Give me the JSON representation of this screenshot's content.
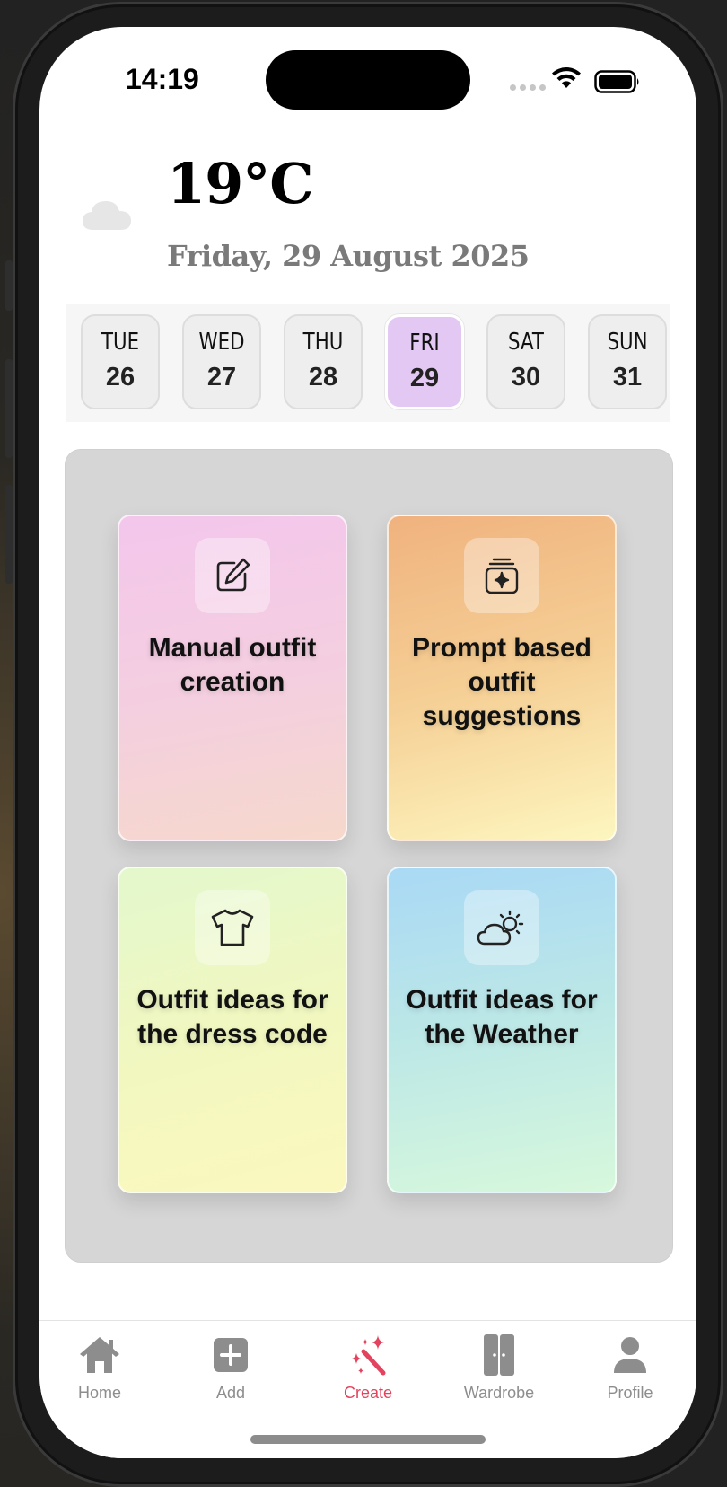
{
  "status_bar": {
    "time": "14:19"
  },
  "weather": {
    "icon": "cloud-icon",
    "temperature": "19°C",
    "date": "Friday, 29 August 2025"
  },
  "days": [
    {
      "name": "TUE",
      "number": "26",
      "selected": false
    },
    {
      "name": "WED",
      "number": "27",
      "selected": false
    },
    {
      "name": "THU",
      "number": "28",
      "selected": false
    },
    {
      "name": "FRI",
      "number": "29",
      "selected": true
    },
    {
      "name": "SAT",
      "number": "30",
      "selected": false
    },
    {
      "name": "SUN",
      "number": "31",
      "selected": false
    }
  ],
  "options": [
    {
      "label": "Manual outfit creation",
      "icon": "edit-icon"
    },
    {
      "label": "Prompt based outfit suggestions",
      "icon": "sparkle-stack-icon"
    },
    {
      "label": "Outfit ideas for the dress code",
      "icon": "tshirt-icon"
    },
    {
      "label": "Outfit ideas for the Weather",
      "icon": "cloud-sun-icon"
    }
  ],
  "tabs": [
    {
      "label": "Home",
      "icon": "house-icon",
      "active": false
    },
    {
      "label": "Add",
      "icon": "plus-square-icon",
      "active": false
    },
    {
      "label": "Create",
      "icon": "magic-wand-icon",
      "active": true
    },
    {
      "label": "Wardrobe",
      "icon": "wardrobe-icon",
      "active": false
    },
    {
      "label": "Profile",
      "icon": "person-icon",
      "active": false
    }
  ],
  "colors": {
    "accent": "#e3435e",
    "inactive_tab": "#8d8d8d",
    "selected_day": "#e2c8f3",
    "panel": "#d6d6d6"
  }
}
